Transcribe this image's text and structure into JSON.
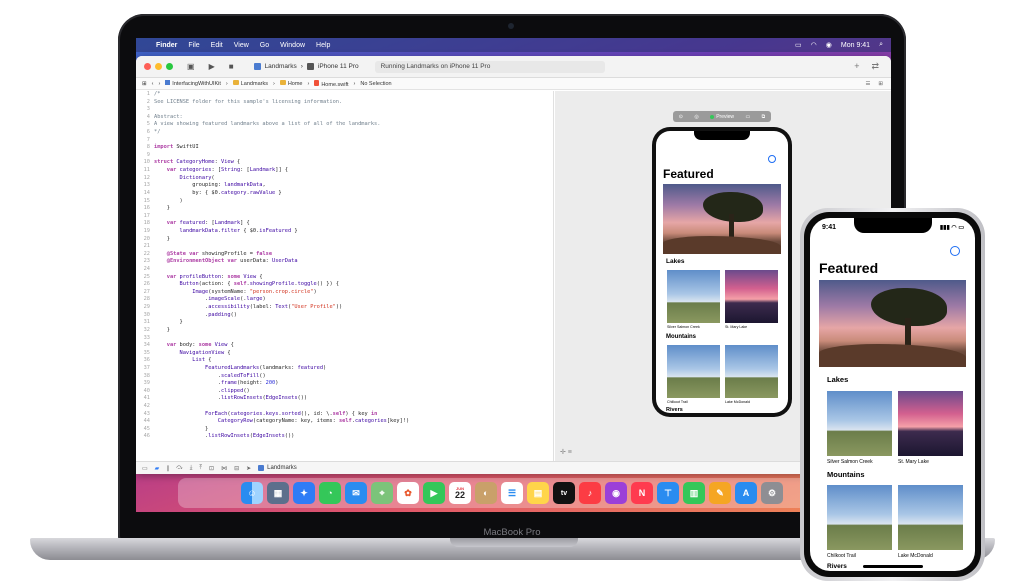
{
  "menubar": {
    "items": [
      "Finder",
      "File",
      "Edit",
      "View",
      "Go",
      "Window",
      "Help"
    ],
    "clock": "Mon 9:41"
  },
  "toolbar": {
    "scheme": "Landmarks",
    "device": "iPhone 11 Pro",
    "activity": "Running Landmarks on iPhone 11 Pro"
  },
  "jumpbar": {
    "crumbs": [
      "InterfacingWithUIKit",
      "Landmarks",
      "Home",
      "Home.swift",
      "No Selection"
    ]
  },
  "editor": {
    "lines": [
      {
        "n": "1",
        "html": "<span class=\"cm\">/*</span>"
      },
      {
        "n": "2",
        "html": "<span class=\"cm\">See LICENSE folder for this sample's licensing information.</span>"
      },
      {
        "n": "3",
        "html": ""
      },
      {
        "n": "4",
        "html": "<span class=\"cm\">Abstract:</span>"
      },
      {
        "n": "5",
        "html": "<span class=\"cm\">A view showing featured landmarks above a list of all of the landmarks.</span>"
      },
      {
        "n": "6",
        "html": "<span class=\"cm\">*/</span>"
      },
      {
        "n": "7",
        "html": ""
      },
      {
        "n": "8",
        "html": "<span class=\"kw\">import</span> SwiftUI"
      },
      {
        "n": "9",
        "html": ""
      },
      {
        "n": "10",
        "html": "<span class=\"kw\">struct</span> <span class=\"ty\">CategoryHome</span>: <span class=\"ty\">View</span> {"
      },
      {
        "n": "11",
        "html": "    <span class=\"kw\">var</span> <span class=\"ty\">categories</span>: [<span class=\"ty\">String</span>: [<span class=\"ty\">Landmark</span>]] {"
      },
      {
        "n": "12",
        "html": "        <span class=\"ty\">Dictionary</span>("
      },
      {
        "n": "13",
        "html": "            grouping: <span class=\"ty\">landmarkData</span>,"
      },
      {
        "n": "14",
        "html": "            by: { $0.<span class=\"ty\">category</span>.<span class=\"ty\">rawValue</span> }"
      },
      {
        "n": "15",
        "html": "        )"
      },
      {
        "n": "16",
        "html": "    }"
      },
      {
        "n": "17",
        "html": ""
      },
      {
        "n": "18",
        "html": "    <span class=\"kw\">var</span> <span class=\"ty\">featured</span>: [<span class=\"ty\">Landmark</span>] {"
      },
      {
        "n": "19",
        "html": "        <span class=\"ty\">landmarkData</span>.<span class=\"ty\">filter</span> { $0.<span class=\"ty\">isFeatured</span> }"
      },
      {
        "n": "20",
        "html": "    }"
      },
      {
        "n": "21",
        "html": ""
      },
      {
        "n": "22",
        "html": "    <span class=\"kw\">@State</span> <span class=\"kw\">var</span> showingProfile = <span class=\"kw\">false</span>"
      },
      {
        "n": "23",
        "html": "    <span class=\"kw\">@EnvironmentObject</span> <span class=\"kw\">var</span> userData: <span class=\"ty\">UserData</span>"
      },
      {
        "n": "24",
        "html": ""
      },
      {
        "n": "25",
        "html": "    <span class=\"kw\">var</span> <span class=\"ty\">profileButton</span>: <span class=\"kw\">some</span> <span class=\"ty\">View</span> {"
      },
      {
        "n": "26",
        "html": "        <span class=\"ty\">Button</span>(action: { <span class=\"kw\">self</span>.<span class=\"ty\">showingProfile</span>.<span class=\"ty\">toggle</span>() }) {"
      },
      {
        "n": "27",
        "html": "            <span class=\"ty\">Image</span>(systemName: <span class=\"st\">\"person.crop.circle\"</span>)"
      },
      {
        "n": "28",
        "html": "                .<span class=\"ty\">imageScale</span>(.<span class=\"ty\">large</span>)"
      },
      {
        "n": "29",
        "html": "                .<span class=\"ty\">accessibility</span>(label: <span class=\"ty\">Text</span>(<span class=\"st\">\"User Profile\"</span>))"
      },
      {
        "n": "30",
        "html": "                .<span class=\"ty\">padding</span>()"
      },
      {
        "n": "31",
        "html": "        }"
      },
      {
        "n": "32",
        "html": "    }"
      },
      {
        "n": "33",
        "html": ""
      },
      {
        "n": "34",
        "html": "    <span class=\"kw\">var</span> body: <span class=\"kw\">some</span> <span class=\"ty\">View</span> {"
      },
      {
        "n": "35",
        "html": "        <span class=\"ty\">NavigationView</span> {"
      },
      {
        "n": "36",
        "html": "            <span class=\"ty\">List</span> {"
      },
      {
        "n": "37",
        "html": "                <span class=\"ty\">FeaturedLandmarks</span>(landmarks: <span class=\"ty\">featured</span>)"
      },
      {
        "n": "38",
        "html": "                    .<span class=\"ty\">scaledToFill</span>()"
      },
      {
        "n": "39",
        "html": "                    .<span class=\"ty\">frame</span>(height: <span class=\"nu\">200</span>)"
      },
      {
        "n": "40",
        "html": "                    .<span class=\"ty\">clipped</span>()"
      },
      {
        "n": "41",
        "html": "                    .<span class=\"ty\">listRowInsets</span>(<span class=\"ty\">EdgeInsets</span>())"
      },
      {
        "n": "42",
        "html": ""
      },
      {
        "n": "43",
        "html": "                <span class=\"ty\">ForEach</span>(<span class=\"ty\">categories</span>.<span class=\"ty\">keys</span>.<span class=\"ty\">sorted</span>(), id: \\.<span class=\"kw\">self</span>) { key <span class=\"kw\">in</span>"
      },
      {
        "n": "44",
        "html": "                    <span class=\"ty\">CategoryRow</span>(categoryName: key, items: <span class=\"kw\">self</span>.<span class=\"ty\">categories</span>[key]!)"
      },
      {
        "n": "45",
        "html": "                }"
      },
      {
        "n": "46",
        "html": "                .<span class=\"ty\">listRowInsets</span>(<span class=\"ty\">EdgeInsets</span>())"
      }
    ]
  },
  "canvas": {
    "preview_label": "Preview"
  },
  "bottombar": {
    "target": "Landmarks"
  },
  "dock": {
    "calendar_month": "JUN",
    "calendar_day": "22",
    "tv_label": "tv"
  },
  "laptop": {
    "model": "MacBook Pro"
  },
  "app": {
    "featured_title": "Featured",
    "sections": [
      {
        "title": "Lakes",
        "items": [
          {
            "label": "Silver Salmon Creek",
            "style": "mountain"
          },
          {
            "label": "St. Mary Lake",
            "style": "sunset"
          }
        ]
      },
      {
        "title": "Mountains",
        "items": [
          {
            "label": "Chilkoot Trail",
            "style": "mountain"
          },
          {
            "label": "Lake McDonald",
            "style": "mountain"
          }
        ]
      },
      {
        "title": "Rivers",
        "items": []
      }
    ]
  },
  "iphone": {
    "time": "9:41"
  },
  "colors": {
    "accent": "#1d6df3",
    "wallpaper_start": "#3b64c7",
    "wallpaper_end": "#f08a54"
  }
}
